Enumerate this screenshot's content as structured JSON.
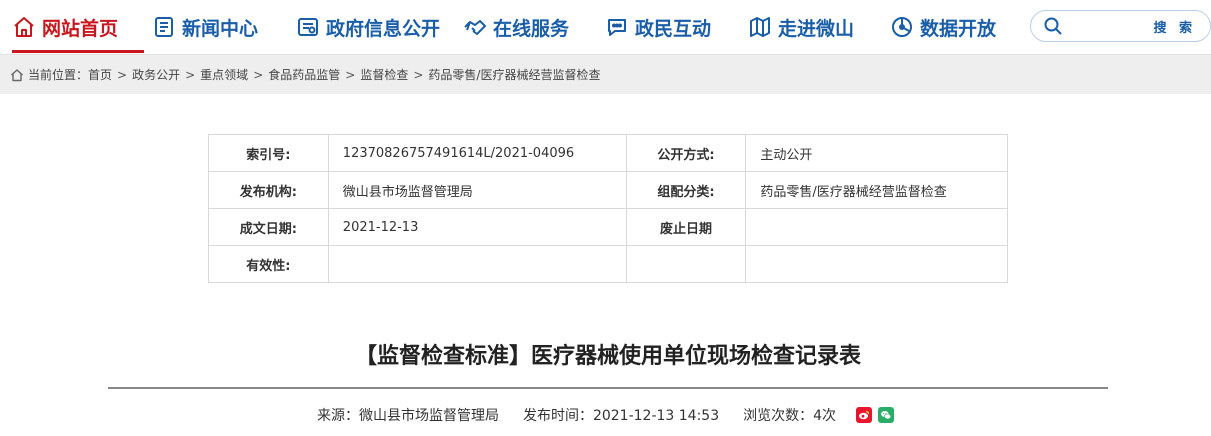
{
  "nav": {
    "items": [
      {
        "label": "网站首页",
        "icon": "home-icon",
        "active": true
      },
      {
        "label": "新闻中心",
        "icon": "news-icon"
      },
      {
        "label": "政府信息公开",
        "icon": "info-open-icon"
      },
      {
        "label": "在线服务",
        "icon": "handshake-icon"
      },
      {
        "label": "政民互动",
        "icon": "chat-icon"
      },
      {
        "label": "走进微山",
        "icon": "map-icon"
      },
      {
        "label": "数据开放",
        "icon": "data-icon"
      }
    ],
    "search": {
      "placeholder": "",
      "button_label": "搜 索"
    },
    "colors": {
      "primary": "#1a5ea8",
      "active": "#c8171e"
    }
  },
  "breadcrumb": {
    "prefix": "当前位置：",
    "items": [
      "首页",
      "政务公开",
      "重点领域",
      "食品药品监管",
      "监督检查",
      "药品零售/医疗器械经营监督检查"
    ]
  },
  "info": {
    "index_label": "索引号:",
    "index_value": "12370826757491614L/2021-04096",
    "open_label": "公开方式:",
    "open_value": "主动公开",
    "publisher_label": "发布机构:",
    "publisher_value": "微山县市场监督管理局",
    "category_label": "组配分类:",
    "category_value": "药品零售/医疗器械经营监督检查",
    "date_label": "成文日期:",
    "date_value": "2021-12-13",
    "abolish_label": "废止日期",
    "abolish_value": "",
    "validity_label": "有效性:",
    "validity_value": ""
  },
  "article": {
    "title": "【监督检查标准】医疗器械使用单位现场检查记录表",
    "source": "来源：微山县市场监督管理局",
    "publish_time": "发布时间：2021-12-13 14:53",
    "views": "浏览次数：4次"
  }
}
